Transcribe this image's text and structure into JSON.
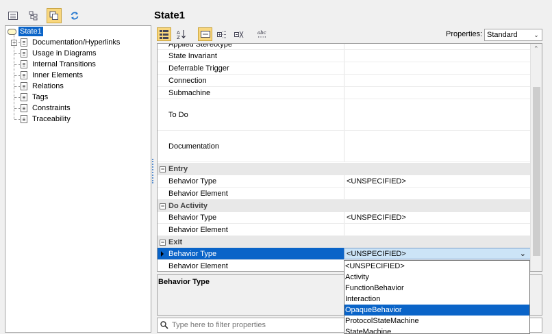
{
  "title": "State1",
  "tree": {
    "root": "State1",
    "items": [
      "Documentation/Hyperlinks",
      "Usage in Diagrams",
      "Internal Transitions",
      "Inner Elements",
      "Relations",
      "Tags",
      "Constraints",
      "Traceability"
    ]
  },
  "properties": {
    "label": "Properties:",
    "mode": "Standard",
    "partial_row": "Applied Stereotype",
    "rows_top": [
      {
        "name": "State Invariant",
        "value": ""
      },
      {
        "name": "Deferrable Trigger",
        "value": ""
      },
      {
        "name": "Connection",
        "value": ""
      },
      {
        "name": "Submachine",
        "value": ""
      },
      {
        "name": "To Do",
        "value": ""
      },
      {
        "name": "Documentation",
        "value": ""
      }
    ],
    "groups": [
      {
        "name": "Entry",
        "rows": [
          {
            "name": "Behavior Type",
            "value": "<UNSPECIFIED>"
          },
          {
            "name": "Behavior Element",
            "value": ""
          }
        ]
      },
      {
        "name": "Do Activity",
        "rows": [
          {
            "name": "Behavior Type",
            "value": "<UNSPECIFIED>"
          },
          {
            "name": "Behavior Element",
            "value": ""
          }
        ]
      },
      {
        "name": "Exit",
        "rows": [
          {
            "name": "Behavior Type",
            "value": "<UNSPECIFIED>"
          },
          {
            "name": "Behavior Element",
            "value": ""
          }
        ]
      }
    ]
  },
  "description": {
    "title": "Behavior Type"
  },
  "filter": {
    "placeholder": "Type here to filter properties"
  },
  "dropdown": {
    "options": [
      "<UNSPECIFIED>",
      "Activity",
      "FunctionBehavior",
      "Interaction",
      "OpaqueBehavior",
      "ProtocolStateMachine",
      "StateMachine"
    ],
    "highlighted": "OpaqueBehavior"
  },
  "colors": {
    "selection": "#0a64c8",
    "active_button": "#f9d77e"
  }
}
